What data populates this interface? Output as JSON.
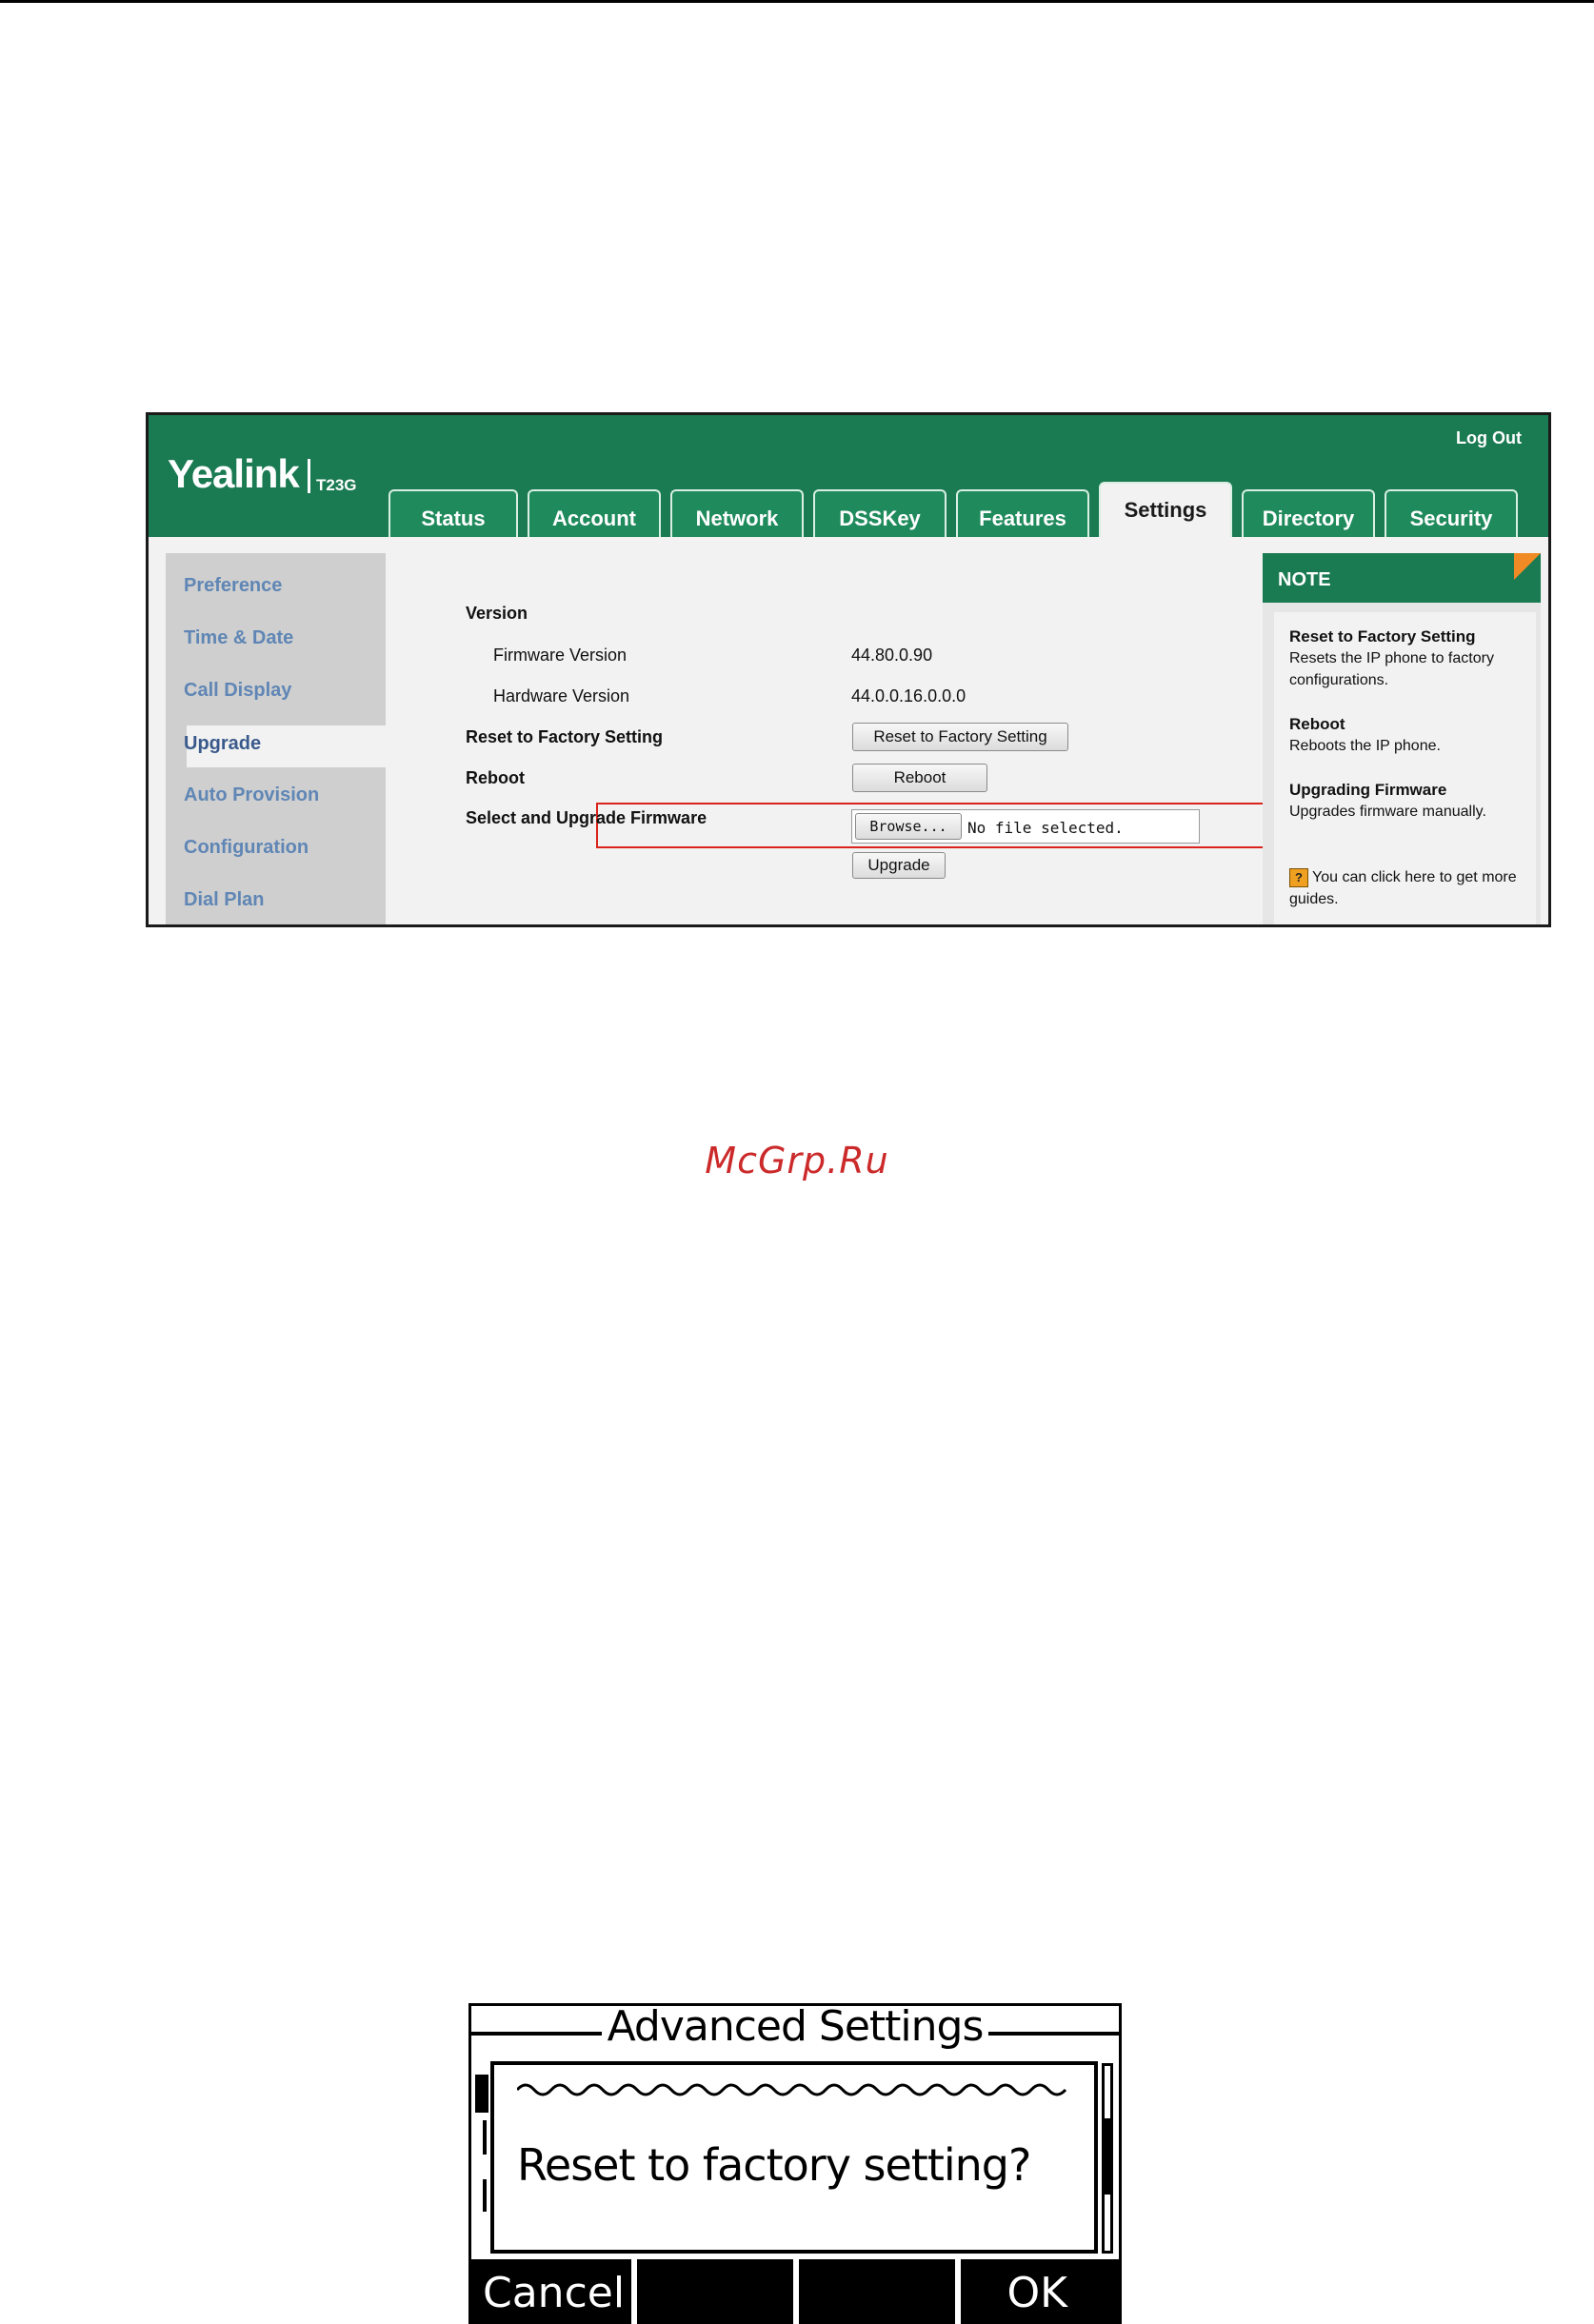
{
  "web": {
    "brand": "Yealink",
    "model": "T23G",
    "logout": "Log Out",
    "tabs": [
      "Status",
      "Account",
      "Network",
      "DSSKey",
      "Features",
      "Settings",
      "Directory",
      "Security"
    ],
    "active_tab": "Settings",
    "sidebar": [
      "Preference",
      "Time & Date",
      "Call Display",
      "Upgrade",
      "Auto Provision",
      "Configuration",
      "Dial Plan"
    ],
    "active_sidebar": "Upgrade",
    "version_heading": "Version",
    "firmware_label": "Firmware Version",
    "firmware_value": "44.80.0.90",
    "hardware_label": "Hardware Version",
    "hardware_value": "44.0.0.16.0.0.0",
    "reset_label": "Reset to Factory Setting",
    "reset_button": "Reset to Factory Setting",
    "reboot_label": "Reboot",
    "reboot_button": "Reboot",
    "upgrade_label": "Select and Upgrade Firmware",
    "browse_button": "Browse...",
    "file_status": "No file selected.",
    "upgrade_button": "Upgrade",
    "note": {
      "title": "NOTE",
      "reset_title": "Reset to Factory Setting",
      "reset_text": "Resets the IP phone to factory configurations.",
      "reboot_title": "Reboot",
      "reboot_text": "Reboots the IP phone.",
      "upgrade_title": "Upgrading Firmware",
      "upgrade_text": "Upgrades firmware manually.",
      "guide_text": "You can click here to get more guides."
    },
    "colors": {
      "header": "#1a7a52",
      "highlight": "#d9241c",
      "sidebar_link": "#5f86b5"
    }
  },
  "watermark": "McGrp.Ru",
  "lcd": {
    "title": "Advanced Settings",
    "prompt": "Reset to factory setting?",
    "softkeys": [
      "Cancel",
      "",
      "",
      "OK"
    ]
  }
}
